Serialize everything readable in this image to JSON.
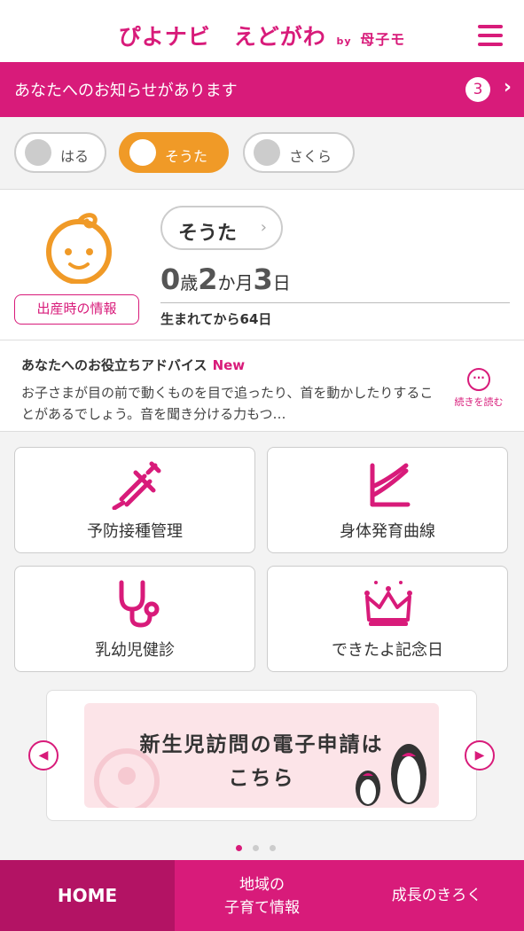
{
  "header": {
    "app_name": "ぴよナビ　えどがわ",
    "by": "by",
    "sub_brand": "母子モ",
    "menu_icon": "hamburger-icon",
    "brand_color": "#d81b7a"
  },
  "notice": {
    "text": "あなたへのお知らせがあります",
    "count": "3",
    "chevron": "›"
  },
  "children": [
    {
      "name": "はる",
      "active": false
    },
    {
      "name": "そうた",
      "active": true
    },
    {
      "name": "さくら",
      "active": false
    }
  ],
  "profile": {
    "name": "そうた",
    "name_chevron": "›",
    "birth_info_label": "出産時の情報",
    "age_years": "0",
    "age_years_unit": "歳",
    "age_months": "2",
    "age_months_unit": "か月",
    "age_days": "3",
    "age_days_unit": "日",
    "since_birth": "生まれてから64日"
  },
  "advice": {
    "title": "あなたへのお役立ちアドバイス",
    "badge": "New",
    "body": "お子さまが目の前で動くものを目で追ったり、首を動かしたりすることがあるでしょう。音を聞き分ける力もつ…",
    "more_label": "続きを読む",
    "more_icon_text": "···"
  },
  "menu": [
    {
      "label": "予防接種管理",
      "icon": "syringe-icon"
    },
    {
      "label": "身体発育曲線",
      "icon": "growth-curve-icon"
    },
    {
      "label": "乳幼児健診",
      "icon": "stethoscope-icon"
    },
    {
      "label": "できたよ記念日",
      "icon": "crown-icon"
    }
  ],
  "banner": {
    "line1": "新生児訪問の電子申請は",
    "line2": "こちら",
    "prev": "◀",
    "next": "▶",
    "current_slide": 1,
    "total_slides": 3
  },
  "bottom_nav": {
    "home": "HOME",
    "local_line1": "地域の",
    "local_line2": "子育て情報",
    "growth": "成長のきろく"
  }
}
